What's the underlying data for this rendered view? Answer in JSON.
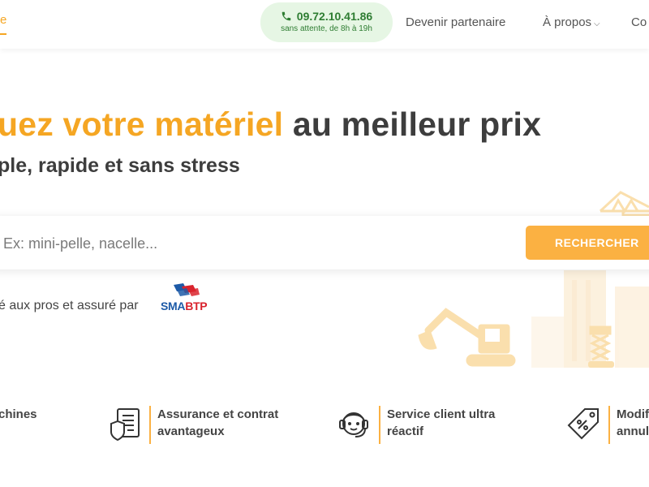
{
  "header": {
    "nav_partial": "e",
    "phone": {
      "number": "09.72.10.41.86",
      "hours": "sans attente, de 8h à 19h"
    },
    "nav_items": [
      "Devenir partenaire",
      "À propos",
      "Co"
    ]
  },
  "hero": {
    "title_accent": "uez votre matériel",
    "title_rest": "au meilleur prix",
    "subtitle": "ple, rapide et sans stress"
  },
  "search": {
    "placeholder": "Ex: mini-pelle, nacelle...",
    "button_label": "RECHERCHER"
  },
  "trust": {
    "text": "é aux pros et assuré par",
    "logo_sma": "SMA",
    "logo_btp": "BTP"
  },
  "features": [
    {
      "icon": "machine-icon",
      "line1": "chines",
      "line2": ""
    },
    {
      "icon": "contract-shield-icon",
      "line1": "Assurance et contrat",
      "line2": "avantageux"
    },
    {
      "icon": "headset-agent-icon",
      "line1": "Service client ultra",
      "line2": "réactif"
    },
    {
      "icon": "discount-tag-icon",
      "line1": "Modif",
      "line2": "annul"
    }
  ],
  "colors": {
    "accent": "#f5a623",
    "button": "#fbb142",
    "phone_bg": "#e6f6e4",
    "phone_text": "#2e7d32",
    "text_dark": "#3d3d3d"
  }
}
